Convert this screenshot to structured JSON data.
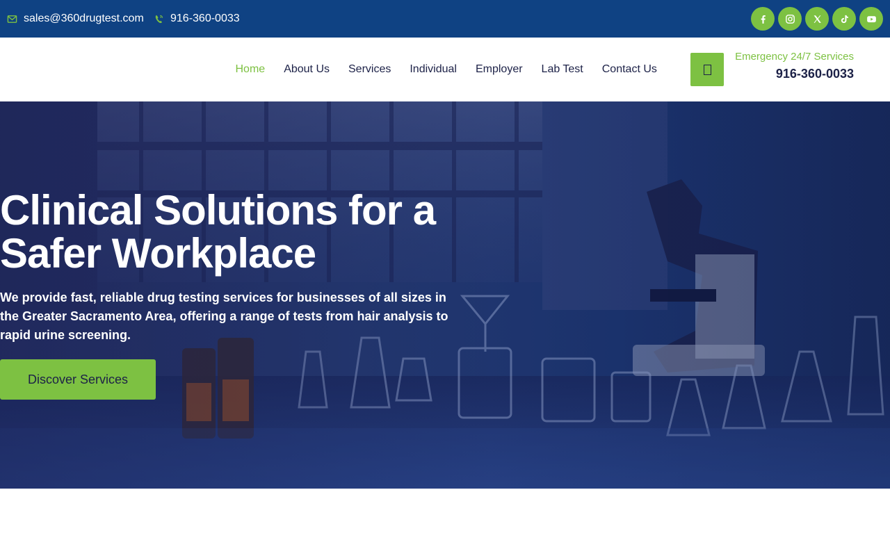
{
  "topbar": {
    "email": "sales@360drugtest.com",
    "phone": "916-360-0033",
    "email_icon": "mail-icon",
    "phone_icon": "phone-icon",
    "socials": [
      {
        "name": "facebook-icon"
      },
      {
        "name": "instagram-icon"
      },
      {
        "name": "x-icon"
      },
      {
        "name": "tiktok-icon"
      },
      {
        "name": "youtube-icon"
      }
    ]
  },
  "nav": {
    "items": [
      "Home",
      "About Us",
      "Services",
      "Individual",
      "Employer",
      "Lab Test",
      "Contact Us"
    ],
    "active": "Home"
  },
  "emergency": {
    "label": "Emergency 24/7 Services",
    "phone": "916-360-0033",
    "icon": "missing-glyph-icon"
  },
  "hero": {
    "title": "Clinical Solutions for a Safer Workplace",
    "subtitle": "We provide fast, reliable drug testing services for businesses of all sizes in the Greater Sacramento Area, offering a range of tests from hair analysis to rapid urine screening.",
    "cta": "Discover Services"
  },
  "colors": {
    "topbar_bg": "#0f4283",
    "accent_green": "#7dc142",
    "text_dark": "#1c2147",
    "hero_overlay": "#1c2a66"
  }
}
